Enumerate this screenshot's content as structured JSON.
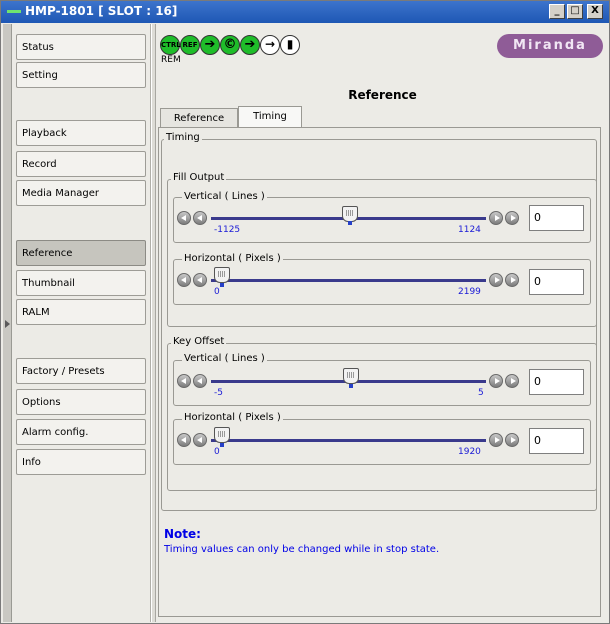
{
  "window": {
    "title": "HMP-1801 [ SLOT : 16]",
    "min": "_",
    "max": "□",
    "close": "X"
  },
  "sidebar": {
    "items": [
      {
        "label": "Status",
        "active": false
      },
      {
        "label": "Setting",
        "active": false
      },
      {
        "label": "Playback",
        "active": false
      },
      {
        "label": "Record",
        "active": false
      },
      {
        "label": "Media Manager",
        "active": false
      },
      {
        "label": "Reference",
        "active": true
      },
      {
        "label": "Thumbnail",
        "active": false
      },
      {
        "label": "RALM",
        "active": false
      },
      {
        "label": "Factory / Presets",
        "active": false
      },
      {
        "label": "Options",
        "active": false
      },
      {
        "label": "Alarm config.",
        "active": false
      },
      {
        "label": "Info",
        "active": false
      }
    ]
  },
  "status_bar": {
    "ctrl": "CTRL",
    "ref": "REF",
    "rem": "REM",
    "icons": [
      "ctrl-icon",
      "ref-icon",
      "arrow-right-icon",
      "copyright-icon",
      "arrow-right-icon",
      "arrow-right-icon",
      "document-icon"
    ]
  },
  "logo": {
    "text": "Miranda",
    "color": "#8f5c97"
  },
  "page": {
    "title": "Reference"
  },
  "tabs": [
    {
      "label": "Reference",
      "selected": false
    },
    {
      "label": "Timing",
      "selected": true
    }
  ],
  "timing": {
    "legend": "Timing",
    "fill_output": {
      "legend": "Fill Output",
      "vertical": {
        "label": "Vertical ( Lines )",
        "min": "-1125",
        "max": "1124",
        "value": "0",
        "position": 0.5
      },
      "horizontal": {
        "label": "Horizontal ( Pixels )",
        "min": "0",
        "max": "2199",
        "value": "0",
        "position": 0.0
      }
    },
    "key_offset": {
      "legend": "Key Offset",
      "vertical": {
        "label": "Vertical ( Lines )",
        "min": "-5",
        "max": "5",
        "value": "0",
        "position": 0.5
      },
      "horizontal": {
        "label": "Horizontal ( Pixels )",
        "min": "0",
        "max": "1920",
        "value": "0",
        "position": 0.0
      }
    }
  },
  "note": {
    "title": "Note:",
    "text": "Timing values can only be changed while in stop state."
  },
  "colors": {
    "accent_blue": "#0000e6",
    "titlebar": "#1e57b4",
    "status_green": "#1fbd2a"
  }
}
